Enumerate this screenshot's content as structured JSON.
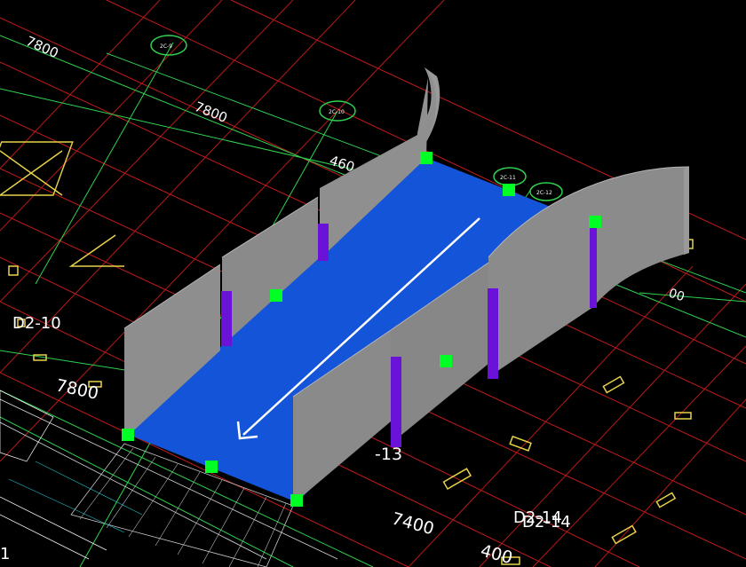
{
  "colors": {
    "background": "#000000",
    "ramp_surface": "#1454d8",
    "wall": "#8c8c8c",
    "wall_top": "#a7a7a7",
    "column": "#6a12d8",
    "grip": "#00ff24",
    "axis_green": "#2fd24f",
    "grid_red": "#cc2020",
    "annotation_yellow": "#e8d24a",
    "arrow": "#ffffff"
  },
  "dimensions": {
    "d1": "7800",
    "d2": "7800",
    "d3": "460",
    "d4": "7800",
    "d5": "7400",
    "d6": "400",
    "d7": "00"
  },
  "labels": {
    "d2_10": "D2-10",
    "d2_13_partial": "-13",
    "d2_14_a": "D2-14",
    "d2_14_b": "D2-14",
    "edge_1": "1"
  },
  "axis_bubbles": {
    "b1": "2C-9",
    "b2": "2C-10",
    "b3": "2C-11",
    "b4": "2C-12"
  },
  "icons": {
    "grip": "square-grip-icon",
    "direction": "ramp-direction-arrow-icon",
    "axis_bubble": "axis-circle-icon"
  }
}
